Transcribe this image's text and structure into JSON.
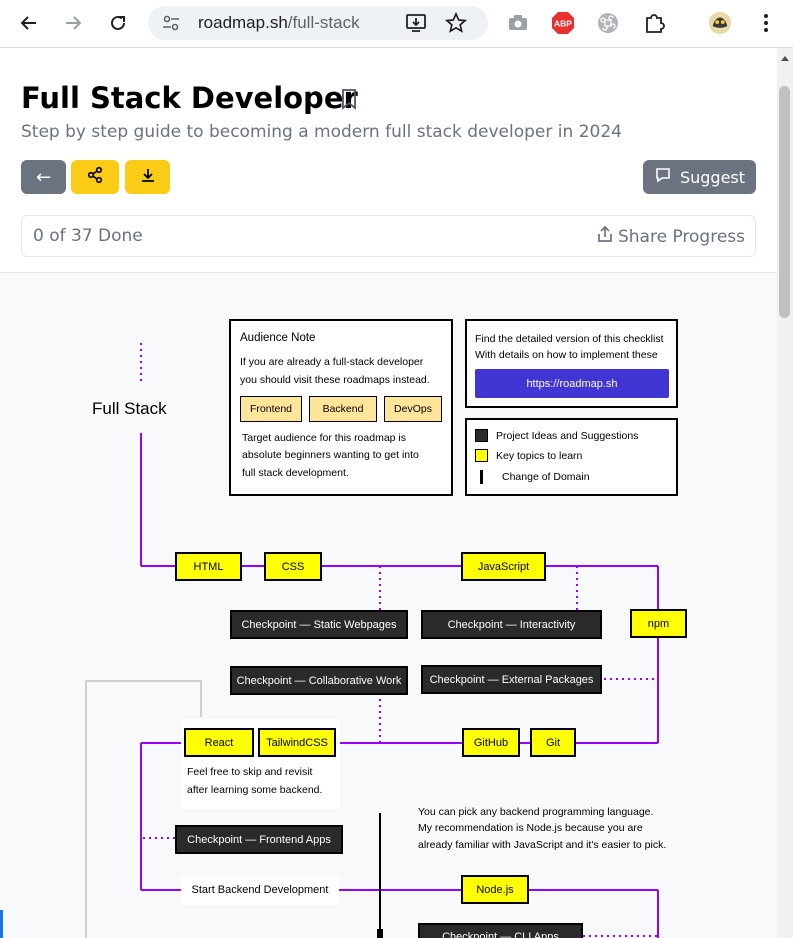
{
  "browser": {
    "url_host": "roadmap.sh",
    "url_path": "/full-stack",
    "ext_abp_label": "ABP"
  },
  "header": {
    "title": "Full Stack Developer",
    "subtitle": "Step by step guide to becoming a modern full stack developer in 2024",
    "back_label": "←",
    "suggest_label": "Suggest"
  },
  "progress": {
    "text": "0 of 37 Done",
    "share_label": "Share Progress"
  },
  "roadmap": {
    "root_label": "Full Stack",
    "audience_note": {
      "title": "Audience Note",
      "intro": [
        "If you are already a full-stack developer",
        "you should visit these roadmaps instead."
      ],
      "links": [
        "Frontend",
        "Backend",
        "DevOps"
      ],
      "target": [
        "Target audience for this roadmap is",
        "absolute beginners wanting to get into",
        "full stack development."
      ]
    },
    "detailed": {
      "text": [
        "Find the detailed version of this checklist",
        "With details on how to implement these"
      ],
      "link_label": "https://roadmap.sh"
    },
    "legend": [
      "Project Ideas and Suggestions",
      "Key topics to learn",
      "Change of Domain"
    ],
    "topics": {
      "html": "HTML",
      "css": "CSS",
      "javascript": "JavaScript",
      "npm": "npm",
      "github": "GitHub",
      "git": "Git",
      "react": "React",
      "tailwind": "TailwindCSS",
      "nodejs": "Node.js"
    },
    "checkpoints": {
      "static": "Checkpoint — Static Webpages",
      "interactivity": "Checkpoint — Interactivity",
      "collaborative": "Checkpoint — Collaborative Work",
      "external": "Checkpoint — External Packages",
      "frontend_apps": "Checkpoint — Frontend Apps",
      "cli_apps": "Checkpoint — CLI Apps"
    },
    "notes": {
      "skip": [
        "Feel free to skip and revisit",
        "after learning some backend."
      ],
      "start_backend": "Start Backend Development",
      "backend_lang": [
        "You can pick any backend programming language.",
        "My recommendation is Node.js because you are",
        "already familiar with JavaScript and it's easier to pick."
      ]
    },
    "colors": {
      "connector": "#9900ff",
      "topic": "#ffff00",
      "checkpoint": "#2a2a2a",
      "link_button": "#4136d4",
      "secondary_button": "#ffe599"
    }
  }
}
